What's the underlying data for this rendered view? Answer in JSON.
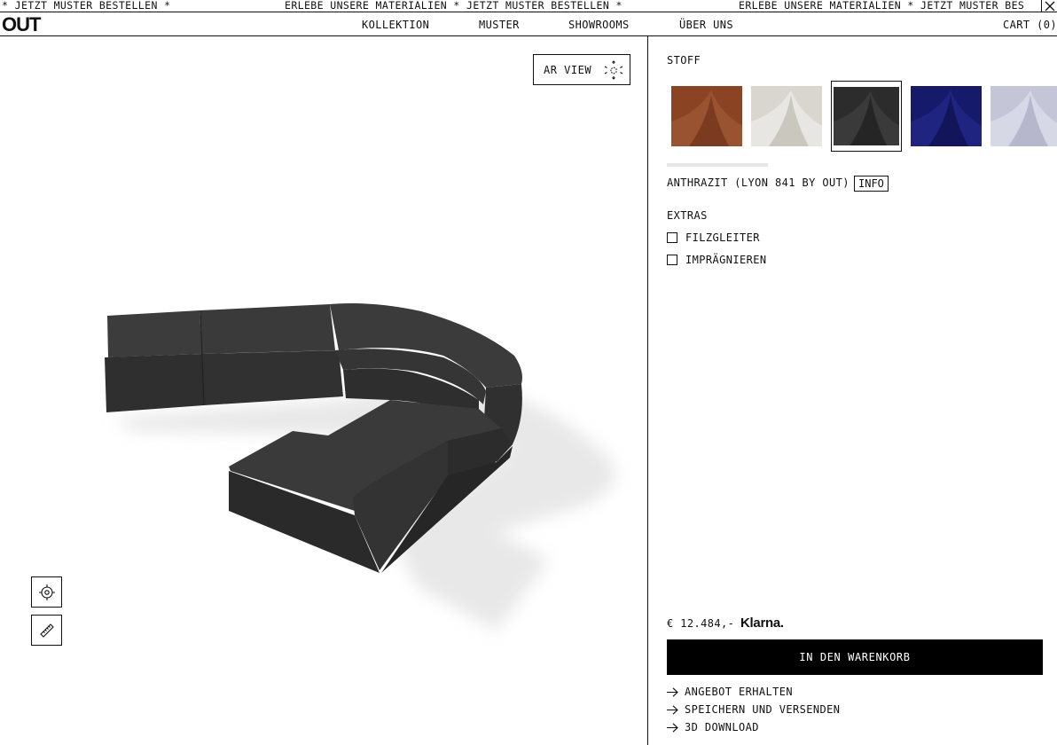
{
  "marquee": {
    "segment1": "* JETZT MUSTER BESTELLEN *",
    "segment2": "ERLEBE UNSERE MATERIALIEN * JETZT MUSTER BESTELLEN *",
    "segment3": "ERLEBE UNSERE MATERIALIEN * JETZT MUSTER BES"
  },
  "nav": {
    "logo": "OUT",
    "links": [
      "KOLLEKTION",
      "MUSTER",
      "SHOWROOMS",
      "ÜBER UNS"
    ],
    "cart": "CART (0)"
  },
  "viewer": {
    "ar_label": "AR VIEW",
    "icons": [
      "ar-cube-icon",
      "target-icon",
      "ruler-icon"
    ],
    "sofa_color": "#3a3a3a"
  },
  "panel": {
    "fabric_heading": "STOFF",
    "swatches": [
      {
        "name": "rust",
        "color": "#8a4424"
      },
      {
        "name": "cream",
        "color": "#d9d6d0"
      },
      {
        "name": "anthracite",
        "color": "#2c2c2c",
        "selected": true
      },
      {
        "name": "navy",
        "color": "#161a6a"
      },
      {
        "name": "light-lilac",
        "color": "#c4c6d8"
      }
    ],
    "selected_fabric": "ANTHRAZIT (LYON 841 BY OUT)",
    "info_label": "INFO",
    "extras_heading": "EXTRAS",
    "extras": [
      "FILZGLEITER",
      "IMPRÄGNIEREN"
    ],
    "price": "€ 12.484,-",
    "klarna": "Klarna.",
    "cart_button": "IN DEN WARENKORB",
    "links": [
      "ANGEBOT ERHALTEN",
      "SPEICHERN UND VERSENDEN",
      "3D DOWNLOAD"
    ]
  }
}
